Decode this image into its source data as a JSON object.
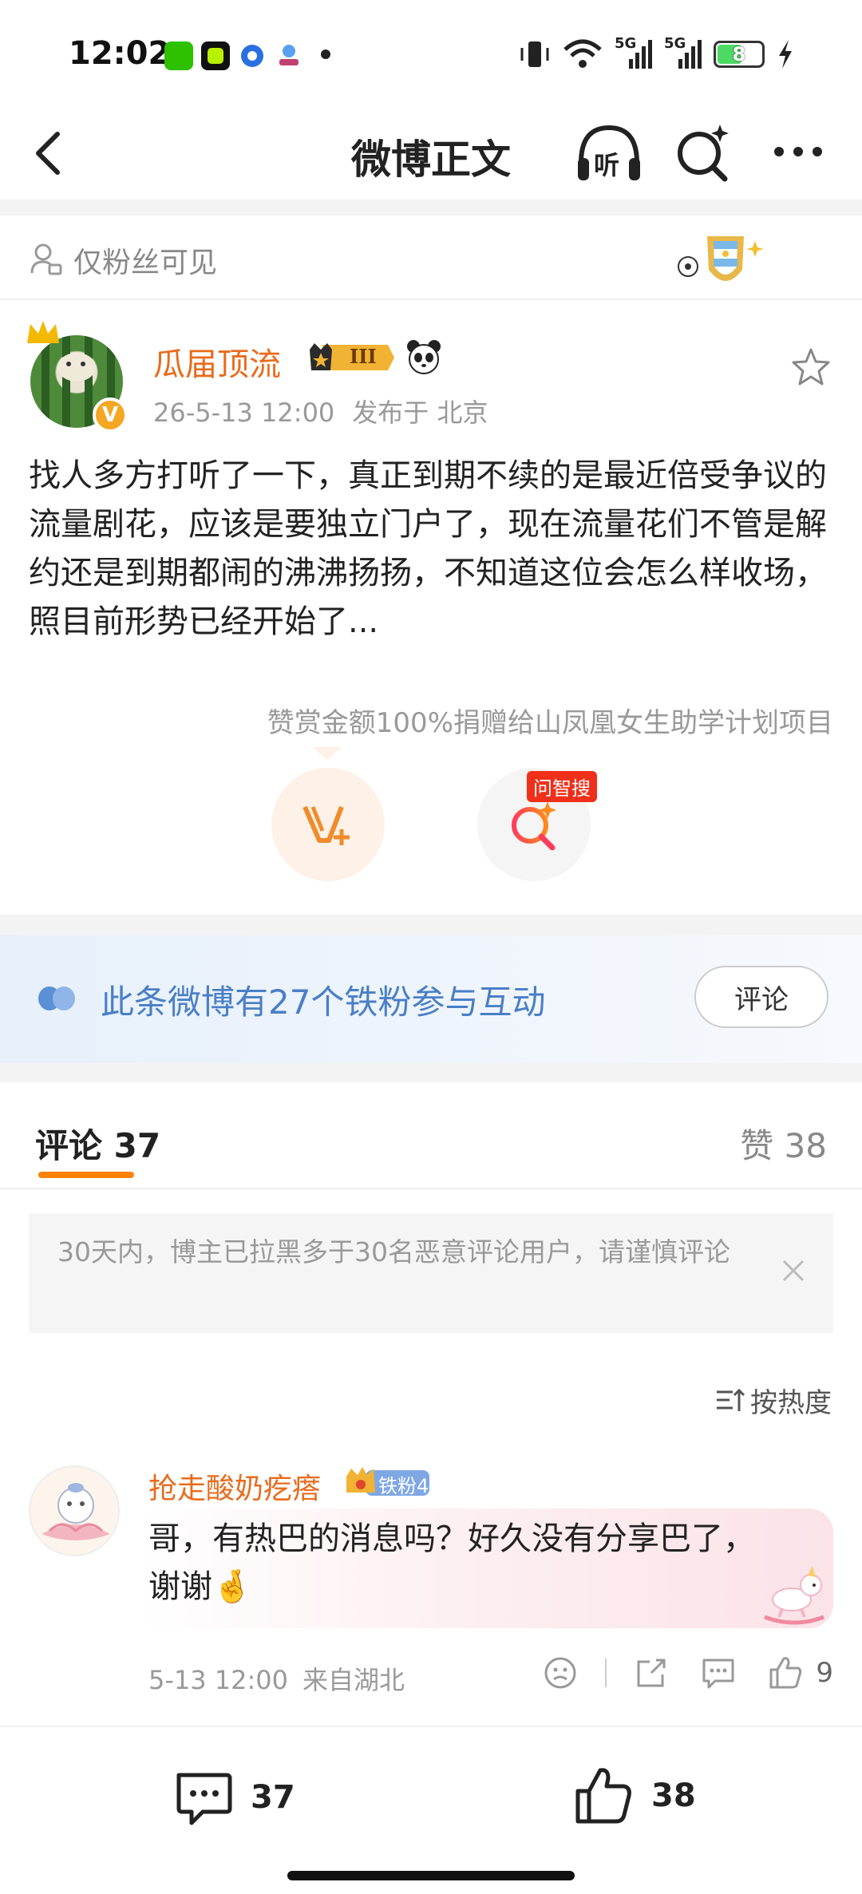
{
  "status_bar": {
    "time": "12:02",
    "battery": "8",
    "signal_1": "5G",
    "signal_2": "5G"
  },
  "nav": {
    "title": "微博正文",
    "listen_label": "听"
  },
  "visibility": {
    "label": "仅粉丝可见"
  },
  "post": {
    "author": "瓜届顶流",
    "vip_level": "III",
    "date": "26-5-13 12:00",
    "location": "发布于 北京",
    "content": "找人多方打听了一下，真正到期不续的是最近倍受争议的流量剧花，应该是要独立门户了，现在流量花们不管是解约还是到期都闹的沸沸扬扬，不知道这位会怎么样收场，照目前形势已经开始了...",
    "reward_note": "赞赏金额100%捐赠给山凤凰女生助学计划项目",
    "ask_tag": "问智搜"
  },
  "fan_banner": {
    "text": "此条微博有27个铁粉参与互动",
    "button": "评论"
  },
  "tabs": {
    "comments": "评论 37",
    "likes": "赞 38"
  },
  "notice": {
    "text": "30天内，博主已拉黑多于30名恶意评论用户，请谨慎评论"
  },
  "sort": {
    "label": "按热度"
  },
  "comment": {
    "user": "抢走酸奶疙瘩",
    "badge": "铁粉4",
    "text": "哥，有热巴的消息吗？好久没有分享巴了，谢谢🤞",
    "date": "5-13 12:00",
    "location": "来自湖北",
    "likes": "9"
  },
  "bottom_bar": {
    "comments": "37",
    "likes": "38"
  },
  "colors": {
    "accent_orange": "#ff8200",
    "username_orange": "#e96b1c",
    "fan_blue": "#4a7fc7",
    "ask_red": "#f0301a"
  }
}
